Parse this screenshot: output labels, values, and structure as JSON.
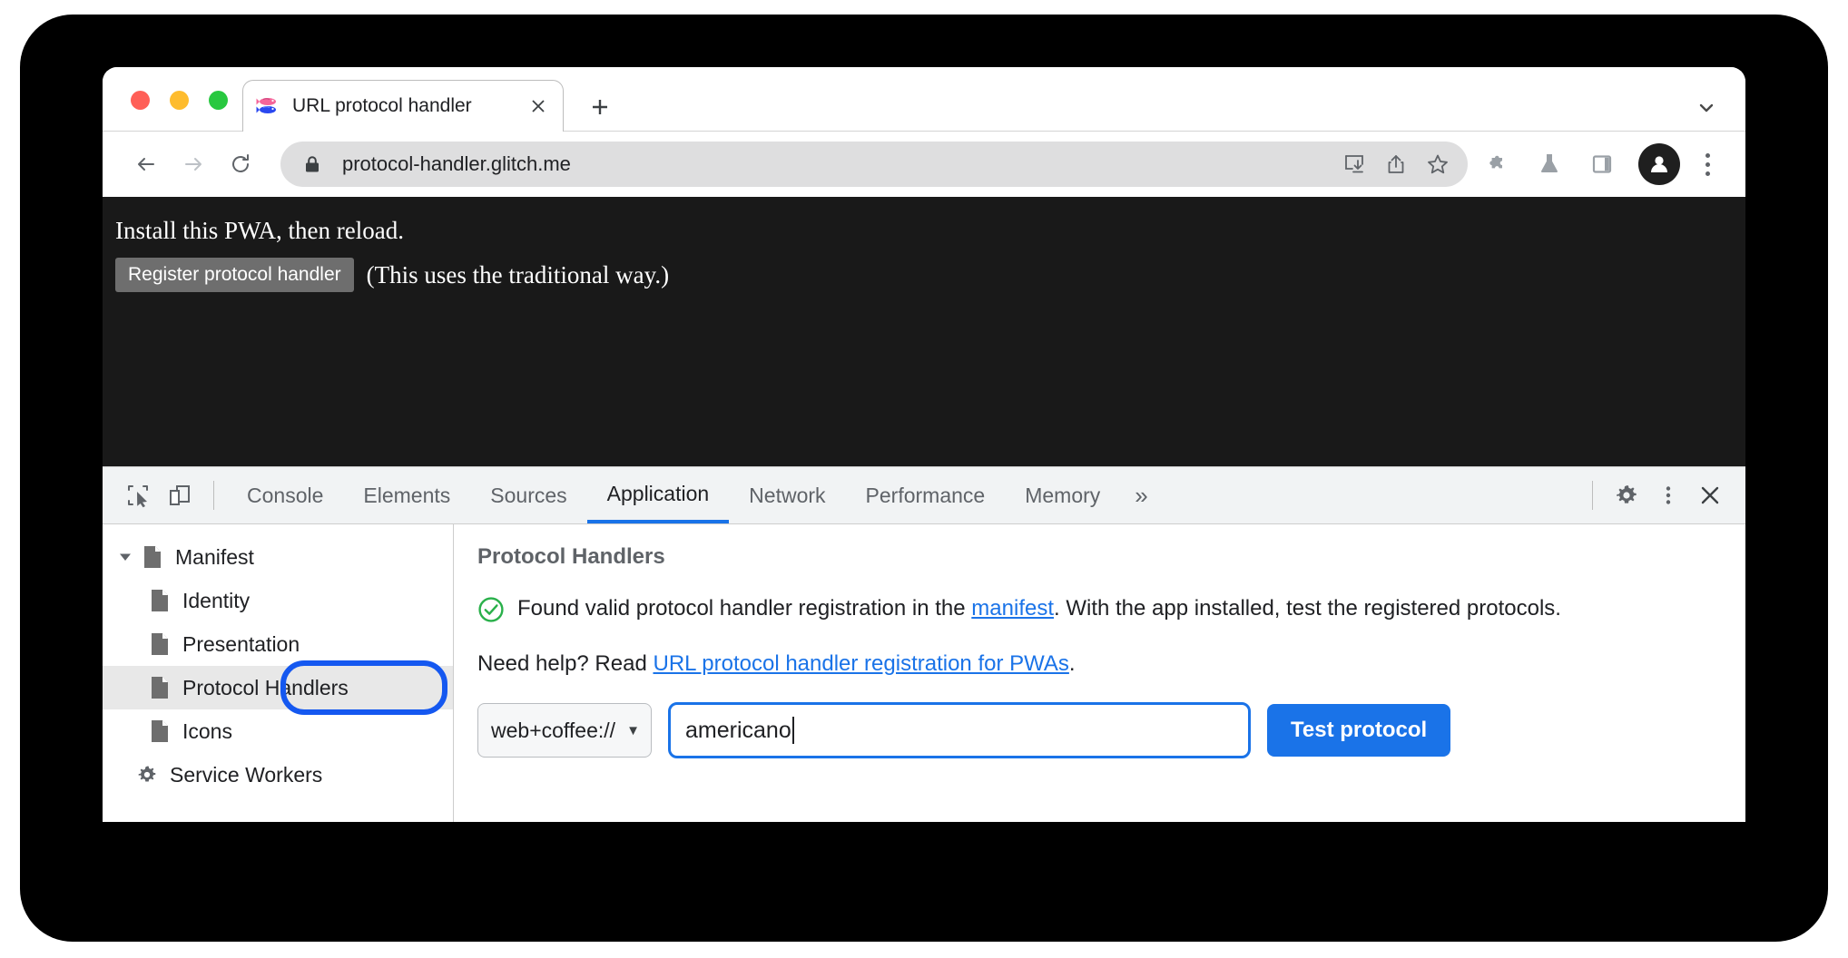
{
  "browser": {
    "tab": {
      "title": "URL protocol handler",
      "favicon": "two-fish-icon",
      "close_label": "×"
    },
    "new_tab_label": "+",
    "tab_list_label": "⌄",
    "toolbar": {
      "back_label": "←",
      "forward_label": "→",
      "reload_label": "↻",
      "lock": "lock-icon",
      "url": "protocol-handler.glitch.me",
      "install_label": "install-icon",
      "share_label": "share-icon",
      "bookmark_label": "star-icon",
      "extensions_label": "puzzle-icon",
      "experiments_label": "flask-icon",
      "side_panel_label": "side-panel-icon",
      "profile_label": "avatar-icon",
      "menu_label": "kebab-menu-icon"
    }
  },
  "page": {
    "heading": "Install this PWA, then reload.",
    "register_button": "Register protocol handler",
    "note": "(This uses the traditional way.)",
    "background": "#191919"
  },
  "devtools": {
    "inspect_label": "inspect-element-icon",
    "device_toggle_label": "device-toolbar-icon",
    "tabs": [
      {
        "label": "Console",
        "active": false
      },
      {
        "label": "Elements",
        "active": false
      },
      {
        "label": "Sources",
        "active": false
      },
      {
        "label": "Application",
        "active": true
      },
      {
        "label": "Network",
        "active": false
      },
      {
        "label": "Performance",
        "active": false
      },
      {
        "label": "Memory",
        "active": false
      }
    ],
    "more_tabs_label": "»",
    "settings_label": "gear-icon",
    "kebab_label": "more-options-icon",
    "close_label": "✕",
    "accent_color": "#1a73e8",
    "sidebar": {
      "items": [
        {
          "label": "Manifest",
          "level": 0,
          "icon": "document-icon",
          "expanded": true,
          "selected": false
        },
        {
          "label": "Identity",
          "level": 1,
          "icon": "document-icon",
          "selected": false
        },
        {
          "label": "Presentation",
          "level": 1,
          "icon": "document-icon",
          "selected": false
        },
        {
          "label": "Protocol Handlers",
          "level": 1,
          "icon": "document-icon",
          "selected": true
        },
        {
          "label": "Icons",
          "level": 1,
          "icon": "document-icon",
          "selected": false
        },
        {
          "label": "Service Workers",
          "level": 0,
          "icon": "gear-icon",
          "selected": false
        }
      ]
    },
    "panel": {
      "title": "Protocol Handlers",
      "status_icon": "green-check-circle-icon",
      "status_color": "#29b04a",
      "status_text_part1": "Found valid protocol handler registration in the ",
      "status_link": "manifest",
      "status_text_part2": ". With the app installed, test the registered protocols.",
      "help_text_prefix": "Need help? Read ",
      "help_link": "URL protocol handler registration for PWAs",
      "help_text_suffix": ".",
      "protocol_select_value": "web+coffee://",
      "protocol_select_caret": "▼",
      "protocol_input_value": "americano",
      "protocol_input_placeholder": "",
      "test_button": "Test protocol"
    }
  }
}
